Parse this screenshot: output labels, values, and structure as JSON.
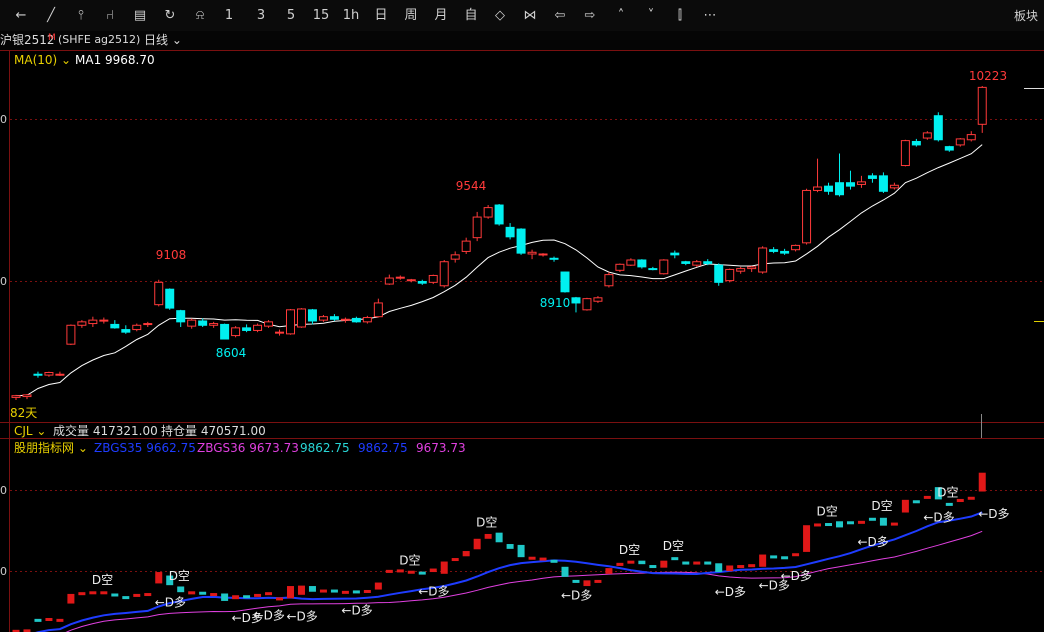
{
  "toolbar": {
    "items": [
      {
        "name": "back-icon",
        "glyph": "←"
      },
      {
        "name": "line-chart-icon",
        "glyph": "╱"
      },
      {
        "name": "kline-icon",
        "glyph": "⫯"
      },
      {
        "name": "tool-icon",
        "glyph": "⑁"
      },
      {
        "name": "news-icon",
        "glyph": "▤"
      },
      {
        "name": "refresh-icon",
        "glyph": "↻"
      },
      {
        "name": "bell-icon",
        "glyph": "⍾"
      },
      {
        "name": "period-1",
        "glyph": "1"
      },
      {
        "name": "period-3",
        "glyph": "3"
      },
      {
        "name": "period-5",
        "glyph": "5"
      },
      {
        "name": "period-15",
        "glyph": "15"
      },
      {
        "name": "period-1h",
        "glyph": "1h"
      },
      {
        "name": "period-day",
        "glyph": "日"
      },
      {
        "name": "period-week",
        "glyph": "周"
      },
      {
        "name": "period-month",
        "glyph": "月"
      },
      {
        "name": "period-custom",
        "glyph": "自"
      },
      {
        "name": "zoom-in-icon",
        "glyph": "◇"
      },
      {
        "name": "zoom-out-icon",
        "glyph": "⋈"
      },
      {
        "name": "left-icon",
        "glyph": "⇦"
      },
      {
        "name": "right-icon",
        "glyph": "⇨"
      },
      {
        "name": "up-icon",
        "glyph": "˄"
      },
      {
        "name": "down-icon",
        "glyph": "˅"
      },
      {
        "name": "split-icon",
        "glyph": "⫿"
      },
      {
        "name": "more-icon",
        "glyph": "⋯"
      }
    ],
    "right_label": "板块"
  },
  "infobar": {
    "symbol": "沪银2512",
    "badge": "M",
    "code": "(SHFE ag2512)",
    "period": "日线"
  },
  "main_indicator": {
    "name": "MA(10)",
    "line_label": "MA1",
    "line_value": "9968.70"
  },
  "labels": {
    "high": "10223",
    "peak1": "9108",
    "peak2": "9544",
    "low1": "8604",
    "low2": "8910",
    "days": "82天",
    "axis_mid_top": "0",
    "axis_mid_bottom": "0",
    "axis_sub_top": "0",
    "axis_sub_bottom": "0"
  },
  "volume_bar": {
    "name": "CJL",
    "vol_label": "成交量",
    "vol_value": "417321.00",
    "oi_label": "持仓量",
    "oi_value": "470571.00"
  },
  "sub_indicator": {
    "name": "股朋指标网",
    "items": [
      {
        "label": "ZBGS35",
        "value": "9662.75",
        "color": "#1e3cff"
      },
      {
        "label": "ZBGS36",
        "value": "9673.73",
        "color": "#e040e0"
      },
      {
        "label": "",
        "value": "9862.75",
        "color": "#29d6d6"
      },
      {
        "label": "",
        "value": "9862.75",
        "color": "#1e3cff"
      },
      {
        "label": "",
        "value": "9673.73",
        "color": "#e040e0"
      }
    ],
    "signal_short": "D空",
    "signal_long": "←D多"
  },
  "colors": {
    "up": "#ff3a3a",
    "down": "#00f0f0",
    "ma": "#ffffff",
    "grid": "#7a1010",
    "ma_blue": "#1e3cff",
    "ma_pink": "#e040e0"
  },
  "chart_data": {
    "type": "candlestick",
    "ma_period": 10,
    "candles": [
      [
        8410,
        8425,
        8395,
        8420
      ],
      [
        8415,
        8430,
        8400,
        8425
      ],
      [
        8545,
        8560,
        8525,
        8540
      ],
      [
        8540,
        8560,
        8530,
        8555
      ],
      [
        8545,
        8560,
        8535,
        8545
      ],
      [
        8720,
        8835,
        8715,
        8830
      ],
      [
        8830,
        8860,
        8815,
        8850
      ],
      [
        8840,
        8880,
        8820,
        8860
      ],
      [
        8860,
        8875,
        8840,
        8860
      ],
      [
        8835,
        8860,
        8810,
        8815
      ],
      [
        8805,
        8830,
        8780,
        8790
      ],
      [
        8805,
        8840,
        8795,
        8830
      ],
      [
        8835,
        8850,
        8820,
        8840
      ],
      [
        8950,
        9095,
        8940,
        9080
      ],
      [
        9040,
        9045,
        8920,
        8930
      ],
      [
        8915,
        8920,
        8820,
        8850
      ],
      [
        8825,
        8870,
        8810,
        8860
      ],
      [
        8855,
        8870,
        8820,
        8830
      ],
      [
        8830,
        8850,
        8815,
        8840
      ],
      [
        8835,
        8840,
        8760,
        8750
      ],
      [
        8770,
        8825,
        8760,
        8815
      ],
      [
        8815,
        8835,
        8790,
        8800
      ],
      [
        8800,
        8840,
        8790,
        8830
      ],
      [
        8825,
        8860,
        8815,
        8850
      ],
      [
        8785,
        8805,
        8770,
        8790
      ],
      [
        8780,
        8925,
        8775,
        8920
      ],
      [
        8820,
        8930,
        8815,
        8925
      ],
      [
        8920,
        8925,
        8835,
        8855
      ],
      [
        8860,
        8890,
        8850,
        8880
      ],
      [
        8880,
        8895,
        8855,
        8865
      ],
      [
        8860,
        8875,
        8845,
        8865
      ],
      [
        8870,
        8880,
        8845,
        8850
      ],
      [
        8850,
        8885,
        8840,
        8875
      ],
      [
        8880,
        8985,
        8875,
        8960
      ],
      [
        9070,
        9125,
        9065,
        9105
      ],
      [
        9105,
        9120,
        9095,
        9110
      ],
      [
        9090,
        9100,
        9080,
        9095
      ],
      [
        9085,
        9095,
        9065,
        9075
      ],
      [
        9080,
        9125,
        9070,
        9120
      ],
      [
        9060,
        9210,
        9050,
        9200
      ],
      [
        9215,
        9260,
        9195,
        9240
      ],
      [
        9260,
        9340,
        9245,
        9320
      ],
      [
        9340,
        9490,
        9320,
        9460
      ],
      [
        9460,
        9530,
        9450,
        9515
      ],
      [
        9530,
        9536,
        9410,
        9420
      ],
      [
        9400,
        9425,
        9330,
        9345
      ],
      [
        9390,
        9395,
        9240,
        9250
      ],
      [
        9245,
        9270,
        9215,
        9255
      ],
      [
        9240,
        9250,
        9230,
        9245
      ],
      [
        9220,
        9230,
        9200,
        9215
      ],
      [
        9140,
        9142,
        9020,
        9025
      ],
      [
        8990,
        8995,
        8905,
        8960
      ],
      [
        8920,
        8990,
        8915,
        8985
      ],
      [
        8970,
        9000,
        8960,
        8990
      ],
      [
        9060,
        9140,
        9050,
        9125
      ],
      [
        9150,
        9190,
        9140,
        9185
      ],
      [
        9180,
        9220,
        9175,
        9210
      ],
      [
        9210,
        9215,
        9160,
        9170
      ],
      [
        9160,
        9170,
        9150,
        9155
      ],
      [
        9130,
        9215,
        9125,
        9210
      ],
      [
        9250,
        9265,
        9220,
        9240
      ],
      [
        9200,
        9205,
        9180,
        9190
      ],
      [
        9180,
        9210,
        9170,
        9200
      ],
      [
        9200,
        9215,
        9180,
        9190
      ],
      [
        9180,
        9190,
        9060,
        9080
      ],
      [
        9090,
        9160,
        9080,
        9155
      ],
      [
        9145,
        9170,
        9130,
        9160
      ],
      [
        9160,
        9175,
        9140,
        9170
      ],
      [
        9140,
        9290,
        9130,
        9280
      ],
      [
        9270,
        9285,
        9250,
        9260
      ],
      [
        9260,
        9275,
        9240,
        9250
      ],
      [
        9270,
        9300,
        9260,
        9295
      ],
      [
        9310,
        9625,
        9300,
        9615
      ],
      [
        9615,
        9800,
        9605,
        9635
      ],
      [
        9640,
        9660,
        9590,
        9610
      ],
      [
        9660,
        9830,
        9580,
        9590
      ],
      [
        9660,
        9730,
        9620,
        9640
      ],
      [
        9650,
        9700,
        9630,
        9665
      ],
      [
        9700,
        9715,
        9660,
        9685
      ],
      [
        9700,
        9720,
        9600,
        9610
      ],
      [
        9630,
        9660,
        9620,
        9645
      ],
      [
        9760,
        9910,
        9755,
        9905
      ],
      [
        9900,
        9915,
        9870,
        9880
      ],
      [
        9920,
        9960,
        9910,
        9950
      ],
      [
        10050,
        10070,
        9900,
        9910
      ],
      [
        9870,
        9875,
        9840,
        9850
      ],
      [
        9880,
        9920,
        9870,
        9915
      ],
      [
        9910,
        9960,
        9900,
        9940
      ],
      [
        10000,
        10223,
        9950,
        10215
      ]
    ],
    "annotations": {
      "high": 10223,
      "low_start": 8395
    }
  }
}
